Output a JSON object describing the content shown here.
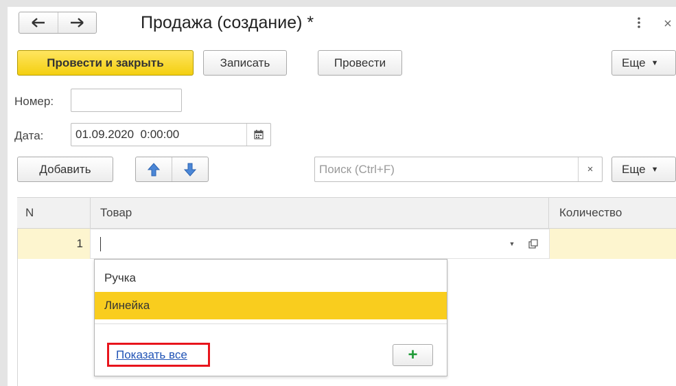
{
  "window": {
    "title": "Продажа (создание) *",
    "back_icon": "arrow-left-icon",
    "forward_icon": "arrow-right-icon",
    "menu_icon": "kebab-menu-icon",
    "close_icon": "close-icon"
  },
  "toolbar": {
    "post_and_close": "Провести и закрыть",
    "save": "Записать",
    "post": "Провести",
    "more": "Еще"
  },
  "fields": {
    "number_label": "Номер:",
    "number_value": "",
    "date_label": "Дата:",
    "date_value": "01.09.2020  0:00:00"
  },
  "table_toolbar": {
    "add": "Добавить",
    "search_placeholder": "Поиск (Ctrl+F)",
    "clear": "×",
    "more": "Еще"
  },
  "table": {
    "columns": [
      "N",
      "Товар",
      "Количество"
    ],
    "rows": [
      {
        "n": "1",
        "product": "",
        "quantity": ""
      }
    ]
  },
  "dropdown": {
    "items": [
      "Ручка",
      "Линейка"
    ],
    "selected_index": 1,
    "show_all": "Показать все",
    "add_icon": "plus-icon"
  },
  "colors": {
    "primary_button": "#f4cf10",
    "selected_item": "#f9cd1e",
    "row_highlight": "#fdf5cf",
    "link": "#2053b5",
    "highlight_border": "#e8141c",
    "plus": "#1f9a37"
  }
}
